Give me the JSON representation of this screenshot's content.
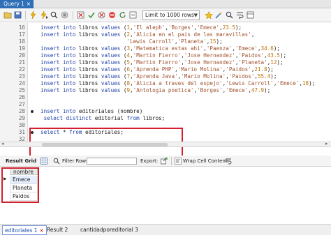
{
  "query_tab": {
    "label": "Query 1",
    "close": "×"
  },
  "toolbar": {
    "limit_label": "Limit to 1000 rows"
  },
  "editor": {
    "lines": [
      {
        "n": "16",
        "segs": [
          [
            "kw",
            "insert into "
          ],
          [
            "",
            "libros "
          ],
          [
            "kw",
            "values "
          ],
          [
            "",
            "("
          ],
          [
            "num",
            "1"
          ],
          [
            "",
            ","
          ],
          [
            "str",
            "'El aleph'"
          ],
          [
            "",
            ","
          ],
          [
            "str",
            "'Borges'"
          ],
          [
            "",
            ","
          ],
          [
            "str",
            "'Emece'"
          ],
          [
            "",
            ","
          ],
          [
            "num",
            "23.5"
          ],
          [
            "",
            ");"
          ]
        ]
      },
      {
        "n": "17",
        "segs": [
          [
            "kw",
            "insert into "
          ],
          [
            "",
            "libros "
          ],
          [
            "kw",
            "values "
          ],
          [
            "",
            "("
          ],
          [
            "num",
            "2"
          ],
          [
            "",
            ","
          ],
          [
            "str",
            "'Alicia en el pais de las maravillas'"
          ],
          [
            "",
            ","
          ]
        ]
      },
      {
        "n": "18",
        "segs": [
          [
            "",
            "                           "
          ],
          [
            "str",
            "'Lewis Carroll'"
          ],
          [
            "",
            ","
          ],
          [
            "str",
            "'Planeta'"
          ],
          [
            "",
            ","
          ],
          [
            "num",
            "15"
          ],
          [
            "",
            ");"
          ]
        ]
      },
      {
        "n": "19",
        "segs": [
          [
            "kw",
            "insert into "
          ],
          [
            "",
            "libros "
          ],
          [
            "kw",
            "values "
          ],
          [
            "",
            "("
          ],
          [
            "num",
            "3"
          ],
          [
            "",
            ","
          ],
          [
            "str",
            "'Matematica estas ahi'"
          ],
          [
            "",
            ","
          ],
          [
            "str",
            "'Paenza'"
          ],
          [
            "",
            ","
          ],
          [
            "str",
            "'Emece'"
          ],
          [
            "",
            ","
          ],
          [
            "num",
            "34.6"
          ],
          [
            "",
            ");"
          ]
        ]
      },
      {
        "n": "20",
        "segs": [
          [
            "kw",
            "insert into "
          ],
          [
            "",
            "libros "
          ],
          [
            "kw",
            "values "
          ],
          [
            "",
            "("
          ],
          [
            "num",
            "4"
          ],
          [
            "",
            ","
          ],
          [
            "str",
            "'Martin Fierro'"
          ],
          [
            "",
            ","
          ],
          [
            "str",
            "'Jose Hernandez'"
          ],
          [
            "",
            ","
          ],
          [
            "str",
            "'Paidos'"
          ],
          [
            "",
            ","
          ],
          [
            "num",
            "43.5"
          ],
          [
            "",
            ");"
          ]
        ]
      },
      {
        "n": "21",
        "segs": [
          [
            "kw",
            "insert into "
          ],
          [
            "",
            "libros "
          ],
          [
            "kw",
            "values "
          ],
          [
            "",
            "("
          ],
          [
            "num",
            "5"
          ],
          [
            "",
            ","
          ],
          [
            "str",
            "'Martin Fierro'"
          ],
          [
            "",
            ","
          ],
          [
            "str",
            "'Jose Hernandez'"
          ],
          [
            "",
            ","
          ],
          [
            "str",
            "'Planeta'"
          ],
          [
            "",
            ","
          ],
          [
            "num",
            "12"
          ],
          [
            "",
            ");"
          ]
        ]
      },
      {
        "n": "22",
        "segs": [
          [
            "kw",
            "insert into "
          ],
          [
            "",
            "libros "
          ],
          [
            "kw",
            "values "
          ],
          [
            "",
            "("
          ],
          [
            "num",
            "6"
          ],
          [
            "",
            ","
          ],
          [
            "str",
            "'Aprenda PHP'"
          ],
          [
            "",
            ","
          ],
          [
            "str",
            "'Mario Molina'"
          ],
          [
            "",
            ","
          ],
          [
            "str",
            "'Paidos'"
          ],
          [
            "",
            ","
          ],
          [
            "num",
            "21.8"
          ],
          [
            "",
            ");"
          ]
        ]
      },
      {
        "n": "23",
        "segs": [
          [
            "kw",
            "insert into "
          ],
          [
            "",
            "libros "
          ],
          [
            "kw",
            "values "
          ],
          [
            "",
            "("
          ],
          [
            "num",
            "7"
          ],
          [
            "",
            ","
          ],
          [
            "str",
            "'Aprenda Java'"
          ],
          [
            "",
            ","
          ],
          [
            "str",
            "'Mario Molina'"
          ],
          [
            "",
            ","
          ],
          [
            "str",
            "'Paidos'"
          ],
          [
            "",
            ","
          ],
          [
            "num",
            "55.4"
          ],
          [
            "",
            ");"
          ]
        ]
      },
      {
        "n": "24",
        "segs": [
          [
            "kw",
            "insert into "
          ],
          [
            "",
            "libros "
          ],
          [
            "kw",
            "values "
          ],
          [
            "",
            "("
          ],
          [
            "num",
            "8"
          ],
          [
            "",
            ","
          ],
          [
            "str",
            "'Alicia a traves del espejo'"
          ],
          [
            "",
            ","
          ],
          [
            "str",
            "'Lewis Carroll'"
          ],
          [
            "",
            ","
          ],
          [
            "str",
            "'Emece'"
          ],
          [
            "",
            ","
          ],
          [
            "num",
            "18"
          ],
          [
            "",
            ");"
          ]
        ]
      },
      {
        "n": "25",
        "segs": [
          [
            "kw",
            "insert into "
          ],
          [
            "",
            "libros "
          ],
          [
            "kw",
            "values "
          ],
          [
            "",
            "("
          ],
          [
            "num",
            "9"
          ],
          [
            "",
            ","
          ],
          [
            "str",
            "'Antologia poetica'"
          ],
          [
            "",
            ","
          ],
          [
            "str",
            "'Borges'"
          ],
          [
            "",
            ","
          ],
          [
            "str",
            "'Emece'"
          ],
          [
            "",
            ","
          ],
          [
            "num",
            "47.9"
          ],
          [
            "",
            ");"
          ]
        ]
      },
      {
        "n": "26",
        "segs": []
      },
      {
        "n": "27",
        "segs": []
      },
      {
        "n": "28",
        "dot": true,
        "segs": [
          [
            "kw",
            "insert into "
          ],
          [
            "",
            "editoriales (nombre)"
          ]
        ]
      },
      {
        "n": "29",
        "segs": [
          [
            "",
            ""
          ],
          [
            "kw",
            " select distinct "
          ],
          [
            "",
            "editorial "
          ],
          [
            "kw",
            "from "
          ],
          [
            "",
            "libros;"
          ]
        ]
      },
      {
        "n": "30",
        "segs": []
      },
      {
        "n": "31",
        "dot": true,
        "segs": [
          [
            "kw",
            "select "
          ],
          [
            "",
            "* "
          ],
          [
            "kw",
            "from "
          ],
          [
            "",
            "editoriales;"
          ]
        ]
      },
      {
        "n": "32",
        "segs": []
      }
    ]
  },
  "result_toolbar": {
    "result_grid": "Result Grid",
    "filter_rows": "Filter Rows:",
    "export": "Export:",
    "wrap": "Wrap Cell Content:"
  },
  "grid": {
    "column": "nombre",
    "rows": [
      "Emece",
      "Planeta",
      "Paidos"
    ]
  },
  "bottom_tabs": {
    "active": "editoriales 1",
    "close": "×",
    "tab2": "Result 2",
    "tab3": "cantidadporeditorial 3"
  },
  "colors": {
    "tab_blue": "#2f6fb7",
    "highlight_red": "#d0202c"
  }
}
